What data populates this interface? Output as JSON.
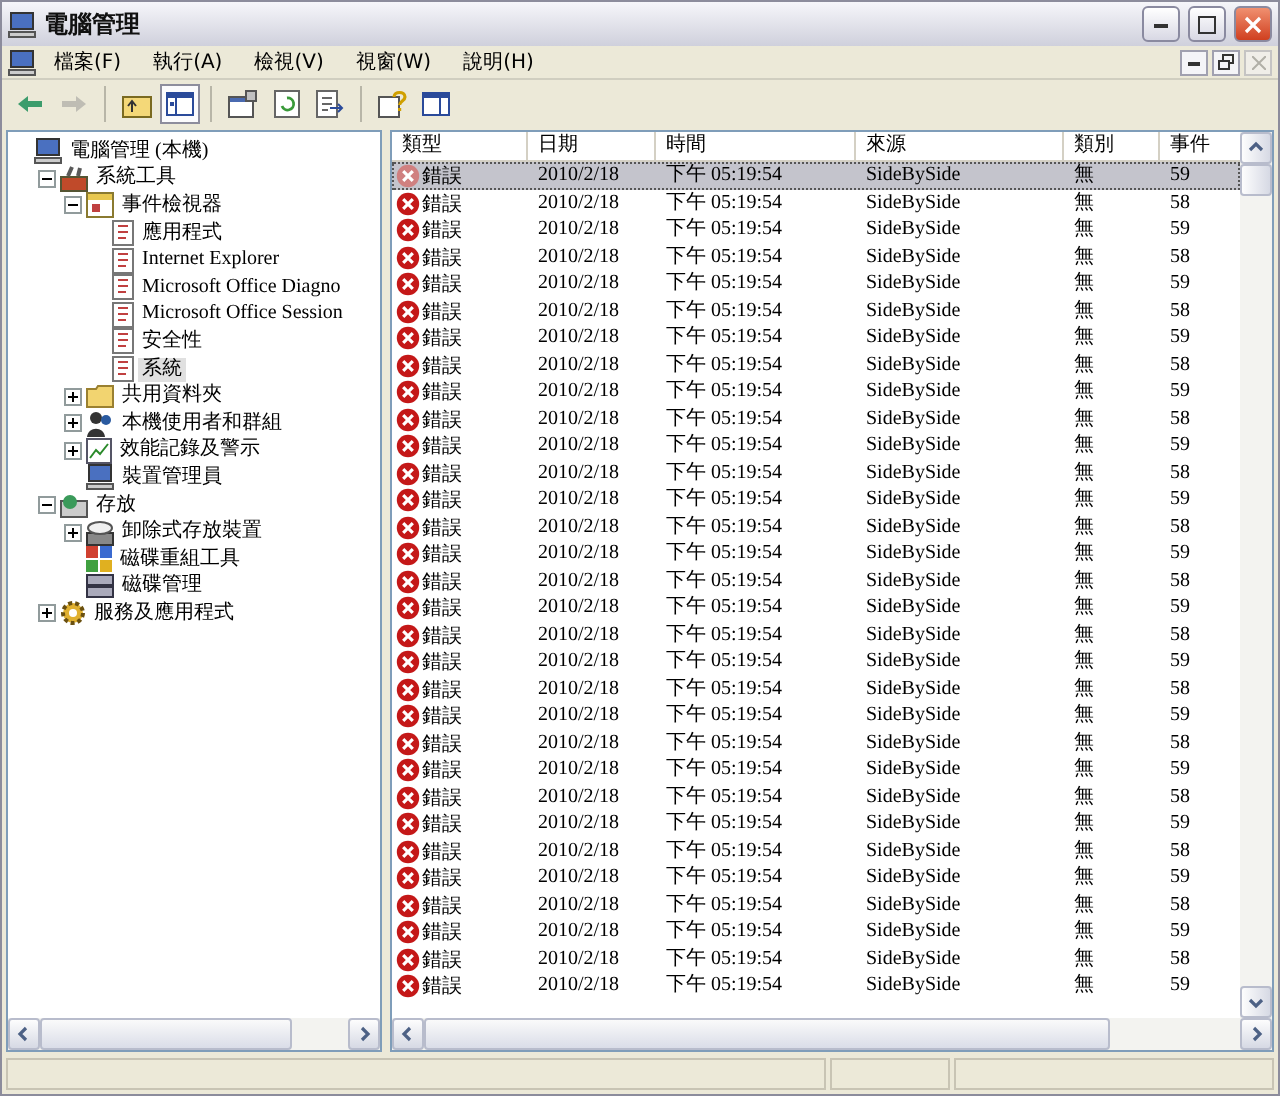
{
  "window": {
    "title": "電腦管理"
  },
  "menu": [
    "檔案(F)",
    "執行(A)",
    "檢視(V)",
    "視窗(W)",
    "說明(H)"
  ],
  "toolbar": [
    {
      "kind": "back",
      "disabled": false,
      "pressed": false
    },
    {
      "kind": "forward",
      "disabled": true,
      "pressed": false
    },
    {
      "kind": "up",
      "disabled": false,
      "pressed": false
    },
    {
      "kind": "tree",
      "disabled": false,
      "pressed": true
    },
    {
      "kind": "properties",
      "disabled": false,
      "pressed": false
    },
    {
      "kind": "refresh",
      "disabled": false,
      "pressed": false
    },
    {
      "kind": "export",
      "disabled": false,
      "pressed": false
    },
    {
      "kind": "help",
      "disabled": false,
      "pressed": false
    },
    {
      "kind": "pane",
      "disabled": false,
      "pressed": false
    }
  ],
  "tree": [
    {
      "label": "電腦管理 (本機)",
      "kind": "computer",
      "selected": false,
      "children": [
        {
          "label": "系統工具",
          "kind": "tools",
          "selected": false,
          "expanded": true,
          "children": [
            {
              "label": "事件檢視器",
              "kind": "viewer",
              "selected": false,
              "expanded": true,
              "children": [
                {
                  "label": "應用程式",
                  "kind": "log",
                  "selected": false
                },
                {
                  "label": "Internet Explorer",
                  "kind": "log",
                  "selected": false
                },
                {
                  "label": "Microsoft Office Diagno",
                  "kind": "log",
                  "selected": false
                },
                {
                  "label": "Microsoft Office Session",
                  "kind": "log",
                  "selected": false
                },
                {
                  "label": "安全性",
                  "kind": "log",
                  "selected": false
                },
                {
                  "label": "系統",
                  "kind": "log",
                  "selected": true
                }
              ]
            },
            {
              "label": "共用資料夾",
              "kind": "folder",
              "selected": false,
              "expanded": false
            },
            {
              "label": "本機使用者和群組",
              "kind": "users",
              "selected": false,
              "expanded": false
            },
            {
              "label": "效能記錄及警示",
              "kind": "perf",
              "selected": false,
              "expanded": false
            },
            {
              "label": "裝置管理員",
              "kind": "computer",
              "selected": false
            }
          ]
        },
        {
          "label": "存放",
          "kind": "storage",
          "selected": false,
          "expanded": true,
          "children": [
            {
              "label": "卸除式存放裝置",
              "kind": "removable",
              "selected": false,
              "expanded": false
            },
            {
              "label": "磁碟重組工具",
              "kind": "defrag",
              "selected": false
            },
            {
              "label": "磁碟管理",
              "kind": "disk",
              "selected": false
            }
          ]
        },
        {
          "label": "服務及應用程式",
          "kind": "services",
          "selected": false,
          "expanded": false
        }
      ]
    }
  ],
  "table": {
    "columns": [
      "類型",
      "日期",
      "時間",
      "來源",
      "類別",
      "事件"
    ],
    "rows": [
      {
        "type": "錯誤",
        "date": "2010/2/18",
        "time": "下午 05:19:54",
        "source": "SideBySide",
        "category": "無",
        "event": "59",
        "selected": true
      },
      {
        "type": "錯誤",
        "date": "2010/2/18",
        "time": "下午 05:19:54",
        "source": "SideBySide",
        "category": "無",
        "event": "58",
        "selected": false
      },
      {
        "type": "錯誤",
        "date": "2010/2/18",
        "time": "下午 05:19:54",
        "source": "SideBySide",
        "category": "無",
        "event": "59",
        "selected": false
      },
      {
        "type": "錯誤",
        "date": "2010/2/18",
        "time": "下午 05:19:54",
        "source": "SideBySide",
        "category": "無",
        "event": "58",
        "selected": false
      },
      {
        "type": "錯誤",
        "date": "2010/2/18",
        "time": "下午 05:19:54",
        "source": "SideBySide",
        "category": "無",
        "event": "59",
        "selected": false
      },
      {
        "type": "錯誤",
        "date": "2010/2/18",
        "time": "下午 05:19:54",
        "source": "SideBySide",
        "category": "無",
        "event": "58",
        "selected": false
      },
      {
        "type": "錯誤",
        "date": "2010/2/18",
        "time": "下午 05:19:54",
        "source": "SideBySide",
        "category": "無",
        "event": "59",
        "selected": false
      },
      {
        "type": "錯誤",
        "date": "2010/2/18",
        "time": "下午 05:19:54",
        "source": "SideBySide",
        "category": "無",
        "event": "58",
        "selected": false
      },
      {
        "type": "錯誤",
        "date": "2010/2/18",
        "time": "下午 05:19:54",
        "source": "SideBySide",
        "category": "無",
        "event": "59",
        "selected": false
      },
      {
        "type": "錯誤",
        "date": "2010/2/18",
        "time": "下午 05:19:54",
        "source": "SideBySide",
        "category": "無",
        "event": "58",
        "selected": false
      },
      {
        "type": "錯誤",
        "date": "2010/2/18",
        "time": "下午 05:19:54",
        "source": "SideBySide",
        "category": "無",
        "event": "59",
        "selected": false
      },
      {
        "type": "錯誤",
        "date": "2010/2/18",
        "time": "下午 05:19:54",
        "source": "SideBySide",
        "category": "無",
        "event": "58",
        "selected": false
      },
      {
        "type": "錯誤",
        "date": "2010/2/18",
        "time": "下午 05:19:54",
        "source": "SideBySide",
        "category": "無",
        "event": "59",
        "selected": false
      },
      {
        "type": "錯誤",
        "date": "2010/2/18",
        "time": "下午 05:19:54",
        "source": "SideBySide",
        "category": "無",
        "event": "58",
        "selected": false
      },
      {
        "type": "錯誤",
        "date": "2010/2/18",
        "time": "下午 05:19:54",
        "source": "SideBySide",
        "category": "無",
        "event": "59",
        "selected": false
      },
      {
        "type": "錯誤",
        "date": "2010/2/18",
        "time": "下午 05:19:54",
        "source": "SideBySide",
        "category": "無",
        "event": "58",
        "selected": false
      },
      {
        "type": "錯誤",
        "date": "2010/2/18",
        "time": "下午 05:19:54",
        "source": "SideBySide",
        "category": "無",
        "event": "59",
        "selected": false
      },
      {
        "type": "錯誤",
        "date": "2010/2/18",
        "time": "下午 05:19:54",
        "source": "SideBySide",
        "category": "無",
        "event": "58",
        "selected": false
      },
      {
        "type": "錯誤",
        "date": "2010/2/18",
        "time": "下午 05:19:54",
        "source": "SideBySide",
        "category": "無",
        "event": "59",
        "selected": false
      },
      {
        "type": "錯誤",
        "date": "2010/2/18",
        "time": "下午 05:19:54",
        "source": "SideBySide",
        "category": "無",
        "event": "58",
        "selected": false
      },
      {
        "type": "錯誤",
        "date": "2010/2/18",
        "time": "下午 05:19:54",
        "source": "SideBySide",
        "category": "無",
        "event": "59",
        "selected": false
      },
      {
        "type": "錯誤",
        "date": "2010/2/18",
        "time": "下午 05:19:54",
        "source": "SideBySide",
        "category": "無",
        "event": "58",
        "selected": false
      },
      {
        "type": "錯誤",
        "date": "2010/2/18",
        "time": "下午 05:19:54",
        "source": "SideBySide",
        "category": "無",
        "event": "59",
        "selected": false
      },
      {
        "type": "錯誤",
        "date": "2010/2/18",
        "time": "下午 05:19:54",
        "source": "SideBySide",
        "category": "無",
        "event": "58",
        "selected": false
      },
      {
        "type": "錯誤",
        "date": "2010/2/18",
        "time": "下午 05:19:54",
        "source": "SideBySide",
        "category": "無",
        "event": "59",
        "selected": false
      },
      {
        "type": "錯誤",
        "date": "2010/2/18",
        "time": "下午 05:19:54",
        "source": "SideBySide",
        "category": "無",
        "event": "58",
        "selected": false
      },
      {
        "type": "錯誤",
        "date": "2010/2/18",
        "time": "下午 05:19:54",
        "source": "SideBySide",
        "category": "無",
        "event": "59",
        "selected": false
      },
      {
        "type": "錯誤",
        "date": "2010/2/18",
        "time": "下午 05:19:54",
        "source": "SideBySide",
        "category": "無",
        "event": "58",
        "selected": false
      },
      {
        "type": "錯誤",
        "date": "2010/2/18",
        "time": "下午 05:19:54",
        "source": "SideBySide",
        "category": "無",
        "event": "59",
        "selected": false
      },
      {
        "type": "錯誤",
        "date": "2010/2/18",
        "time": "下午 05:19:54",
        "source": "SideBySide",
        "category": "無",
        "event": "58",
        "selected": false
      },
      {
        "type": "錯誤",
        "date": "2010/2/18",
        "time": "下午 05:19:54",
        "source": "SideBySide",
        "category": "無",
        "event": "59",
        "selected": false
      }
    ]
  }
}
